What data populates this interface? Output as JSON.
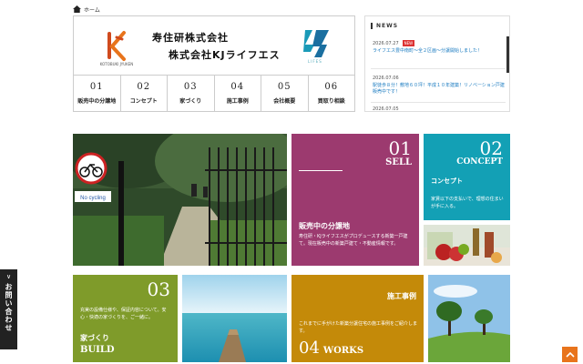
{
  "breadcrumb": {
    "home_label": "ホーム"
  },
  "header": {
    "logo_left_text": "KOTOBUKI JYUKEN",
    "company_line1": "寿住研株式会社",
    "company_line2": "株式会社KJライフエス",
    "logo_right_text": "LIFES"
  },
  "nav": [
    {
      "num": "01",
      "label": "販売中の分譲地"
    },
    {
      "num": "02",
      "label": "コンセプト"
    },
    {
      "num": "03",
      "label": "家づくり"
    },
    {
      "num": "04",
      "label": "施工事例"
    },
    {
      "num": "05",
      "label": "会社概要"
    },
    {
      "num": "06",
      "label": "買取り相談"
    }
  ],
  "news": {
    "title": "NEWS",
    "items": [
      {
        "date": "2026.07.27",
        "badge": "NEW",
        "text": "ライフエス豊中南町～全２区画～分譲開始しました！"
      },
      {
        "date": "2026.07.06",
        "badge": "",
        "text": "駅徒歩８分！敷地６０坪！平成１０年建築！リノベーション戸建販売中です！"
      },
      {
        "date": "2026.07.05",
        "badge": "",
        "text": ""
      }
    ]
  },
  "tiles": {
    "sell": {
      "num": "01",
      "word": "SELL",
      "title": "販売中の分譲地",
      "text": "寿住研・KJライフエスがプロデュースする新築一戸建て。現在販売中の新築戸建て・不動産情報です。",
      "color": "#9c3a6f"
    },
    "concept": {
      "num": "02",
      "word": "CONCEPT",
      "title": "コンセプト",
      "text": "家賃以下の支払いで、理想の住まいが手に入る。",
      "color": "#13a0b5"
    },
    "build": {
      "num": "03",
      "word": "BUILD",
      "title": "家づくり",
      "text": "充実の設備仕様や、保証内容について。安心・快適の家づくりを、ご一緒に。",
      "color": "#7f9b2a"
    },
    "works": {
      "num": "04",
      "word": "WORKS",
      "title": "施工事例",
      "text": "これまでに手がけた新築分譲住宅の施工事例をご紹介します。",
      "color": "#c48a09"
    }
  },
  "side_tab": {
    "label": "お問い合わせ"
  },
  "sign_text": "No cycling"
}
